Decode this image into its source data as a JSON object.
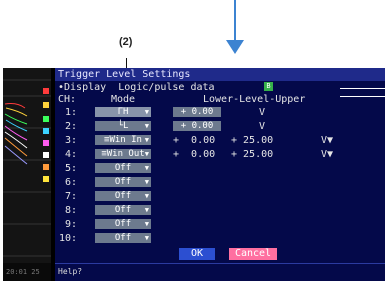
{
  "annotation": {
    "callout_label": "(2)"
  },
  "colors": {
    "arrow": "#3c83d1",
    "dialog_bg": "#04094a",
    "title_bg": "#1f2a8a",
    "ok": "#2c4fd1",
    "cancel": "#ff6fa0"
  },
  "screen": {
    "wave_time": "20:01 25",
    "dialog": {
      "title": "Trigger Level Settings",
      "display_label": "•Display  Logic/pulse data",
      "display_badge": "B",
      "header": {
        "ch": "CH:",
        "mode": "Mode",
        "level": "Lower-Level-Upper"
      },
      "rows": [
        {
          "ch": "1:",
          "mode": "ΓH",
          "lower": "+  0.00",
          "upper": "",
          "unit": "V"
        },
        {
          "ch": "2:",
          "mode": "└L",
          "lower": "+  0.00",
          "upper": "",
          "unit": "V"
        },
        {
          "ch": "3:",
          "mode": "≡Win In",
          "lower": "+  0.00",
          "upper": "+ 25.00",
          "unit": "V▼"
        },
        {
          "ch": "4:",
          "mode": "≡Win Out",
          "lower": "+  0.00",
          "upper": "+ 25.00",
          "unit": "V▼"
        },
        {
          "ch": "5:",
          "mode": "Off",
          "lower": "",
          "upper": "",
          "unit": ""
        },
        {
          "ch": "6:",
          "mode": "Off",
          "lower": "",
          "upper": "",
          "unit": ""
        },
        {
          "ch": "7:",
          "mode": "Off",
          "lower": "",
          "upper": "",
          "unit": ""
        },
        {
          "ch": "8:",
          "mode": "Off",
          "lower": "",
          "upper": "",
          "unit": ""
        },
        {
          "ch": "9:",
          "mode": "Off",
          "lower": "",
          "upper": "",
          "unit": ""
        },
        {
          "ch": "10:",
          "mode": "Off",
          "lower": "",
          "upper": "",
          "unit": ""
        }
      ],
      "ok_label": "OK",
      "cancel_label": "Cancel",
      "help_text": "Help?"
    }
  }
}
